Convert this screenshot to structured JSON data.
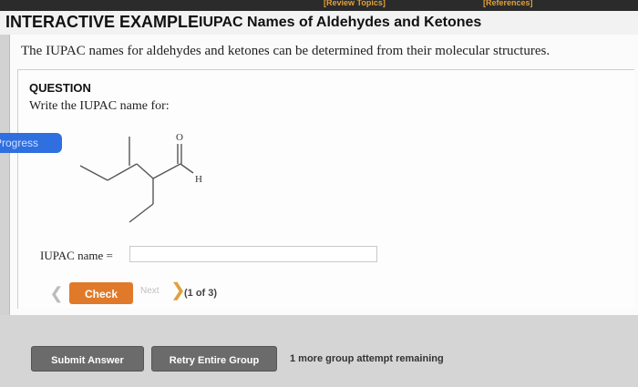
{
  "topbar": {
    "review_link": "[Review Topics]",
    "references_link": "[References]"
  },
  "header": {
    "interactive_label": "INTERACTIVE EXAMPLE",
    "title": "IUPAC Names of Aldehydes and Ketones"
  },
  "intro_text": "The IUPAC names for aldehydes and ketones can be determined from their molecular structures.",
  "question": {
    "heading": "QUESTION",
    "prompt": "Write the IUPAC name for:",
    "progress_tab": "Progress",
    "molecule_atoms": {
      "oxygen": "O",
      "hydrogen": "H"
    },
    "answer_label": "IUPAC name =",
    "answer_value": ""
  },
  "controls": {
    "prev_icon": "chevron-left-icon",
    "check_label": "Check",
    "next_label": "Next",
    "next_icon": "chevron-right-icon",
    "counter": "(1 of 3)"
  },
  "footer": {
    "submit_label": "Submit Answer",
    "retry_label": "Retry Entire Group",
    "remaining_text": "1 more group attempt remaining"
  },
  "colors": {
    "accent_orange": "#e07a2a",
    "progress_blue": "#2f6fe0",
    "button_gray": "#6b6b6b"
  }
}
